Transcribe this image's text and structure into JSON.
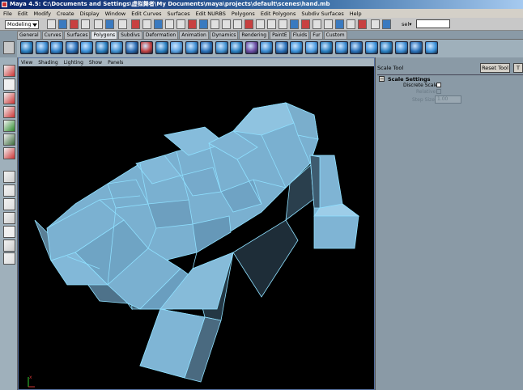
{
  "window": {
    "title": "Maya 4.5: C:\\Documents and Settings\\虚拟舞者\\My Documents\\maya\\projects\\default\\scenes\\hand.mb"
  },
  "menubar": [
    "File",
    "Edit",
    "Modify",
    "Create",
    "Display",
    "Window",
    "Edit Curves",
    "Surfaces",
    "Edit NURBS",
    "Polygons",
    "Edit Polygons",
    "Subdiv Surfaces",
    "Help"
  ],
  "statusline": {
    "mode": "Modeling",
    "sel_label": "sel▾",
    "sel_value": ""
  },
  "shelf": {
    "tabs": [
      "General",
      "Curves",
      "Surfaces",
      "Polygons",
      "Subdivs",
      "Deformation",
      "Animation",
      "Dynamics",
      "Rendering",
      "PaintE",
      "Fluids",
      "Fur",
      "Custom"
    ],
    "active_tab": "Polygons",
    "icon_colors": [
      "#2a7fc0",
      "#3a8ad0",
      "#3080c8",
      "#2a70b8",
      "#3a90d8",
      "#2a7fc0",
      "#4090d0",
      "#2a6ab0",
      "#c04040",
      "#2a7fc0",
      "#5aa0e0",
      "#3a8ad0",
      "#2a70b8",
      "#4090d0",
      "#2a7fc0",
      "#6a4aa0",
      "#3a8ad0",
      "#2a70b8",
      "#3a90d8",
      "#4a9ae0",
      "#2a7fc0",
      "#3a8ad0",
      "#2a70b8",
      "#3a90d8",
      "#2a7fc0",
      "#3a8ad0",
      "#2a70b8",
      "#3a90d8"
    ]
  },
  "panel_menu": [
    "View",
    "Shading",
    "Lighting",
    "Show",
    "Panels"
  ],
  "tool_settings": {
    "title": "Scale Tool",
    "reset_label": "Reset Tool",
    "next_label": "T",
    "section": "Scale Settings",
    "discrete_label": "Discrete Scale",
    "relative_label": "Relative",
    "step_label": "Step Size",
    "step_value": "1.00"
  },
  "viewport": {
    "axis_label": "x",
    "mesh_fill": "#7ab0d0",
    "mesh_edge": "#8fe0ff",
    "background": "#000000"
  }
}
